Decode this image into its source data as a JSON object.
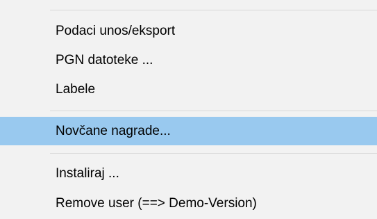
{
  "menu": {
    "items": [
      {
        "label": "Podaci unos/eksport"
      },
      {
        "label": "PGN datoteke ..."
      },
      {
        "label": "Labele"
      },
      {
        "label": "Novčane nagrade...",
        "highlighted": true
      },
      {
        "label": "Instaliraj ..."
      },
      {
        "label": "Remove user (==> Demo-Version)"
      }
    ]
  },
  "colors": {
    "menu_background": "#f2f2f2",
    "highlight": "#99c9ef",
    "separator": "#d7d7d7"
  }
}
